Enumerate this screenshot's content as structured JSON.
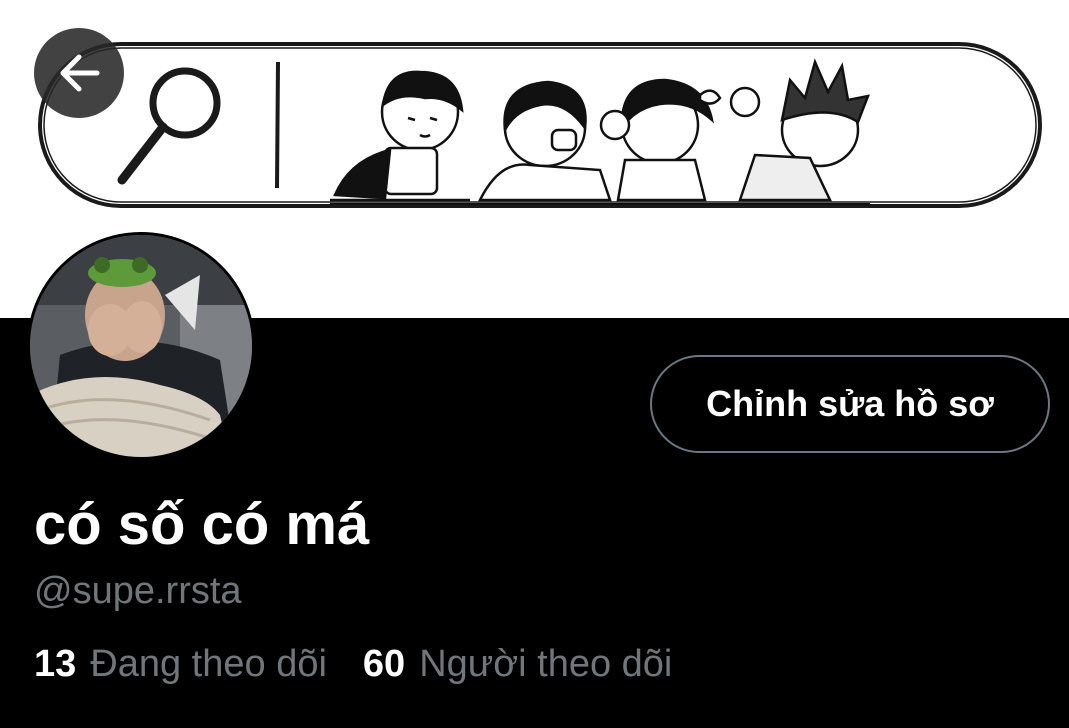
{
  "header": {
    "back_icon": "arrow-left-icon"
  },
  "banner": {
    "description_icon": "search-bar-illustration",
    "search_icon": "magnifier-icon"
  },
  "profile": {
    "display_name": "có số có má",
    "handle": "@supe.rrsta",
    "edit_button_label": "Chỉnh sửa hồ sơ",
    "following_count": "13",
    "following_label": "Đang theo dõi",
    "followers_count": "60",
    "followers_label": "Người theo dõi"
  },
  "colors": {
    "background": "#000000",
    "text_primary": "#ffffff",
    "text_secondary": "#71767b",
    "button_border": "#6b7884",
    "banner_bg": "#ffffff"
  }
}
